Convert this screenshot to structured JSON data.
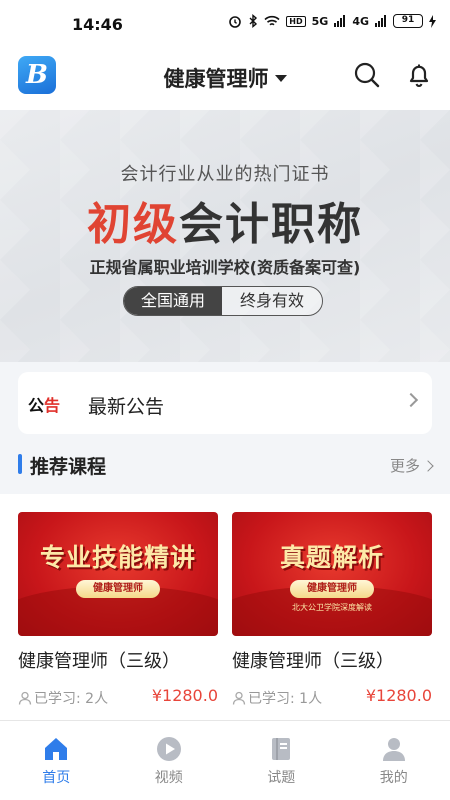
{
  "status_bar": {
    "time": "14:46",
    "net_badge": "HD",
    "signal_1": "5G",
    "signal_2": "4G",
    "battery": "91"
  },
  "header": {
    "logo_letter": "B",
    "title": "健康管理师",
    "icons": [
      "search-icon",
      "bell-icon"
    ]
  },
  "banner": {
    "subtitle": "会计行业从业的热门证书",
    "title_red": "初级",
    "title_dark": "会计职称",
    "description": "正规省属职业培训学校(资质备案可查)",
    "tag_primary": "全国通用",
    "tag_secondary": "终身有效"
  },
  "notice": {
    "logo_part1": "公",
    "logo_part2": "告",
    "text": "最新公告"
  },
  "section": {
    "title": "推荐课程",
    "more": "更多"
  },
  "courses": [
    {
      "thumb_title": "专业技能精讲",
      "thumb_pill": "健康管理师",
      "thumb_note": "",
      "name": "健康管理师（三级）",
      "learned": "已学习: 2人",
      "price": "¥1280.0"
    },
    {
      "thumb_title": "真题解析",
      "thumb_pill": "健康管理师",
      "thumb_note": "北大公卫学院深度解读",
      "name": "健康管理师（三级）",
      "learned": "已学习: 1人",
      "price": "¥1280.0"
    }
  ],
  "tabbar": {
    "active": "home",
    "items": [
      {
        "label": "首页",
        "icon": "home-icon"
      },
      {
        "label": "视频",
        "icon": "video-play-icon"
      },
      {
        "label": "试题",
        "icon": "exam-book-icon"
      },
      {
        "label": "我的",
        "icon": "profile-icon"
      }
    ]
  },
  "colors": {
    "accent": "#2f7dea",
    "price": "#e8453a",
    "banner_red": "#e04433",
    "thumb_red": "#c8161a"
  }
}
